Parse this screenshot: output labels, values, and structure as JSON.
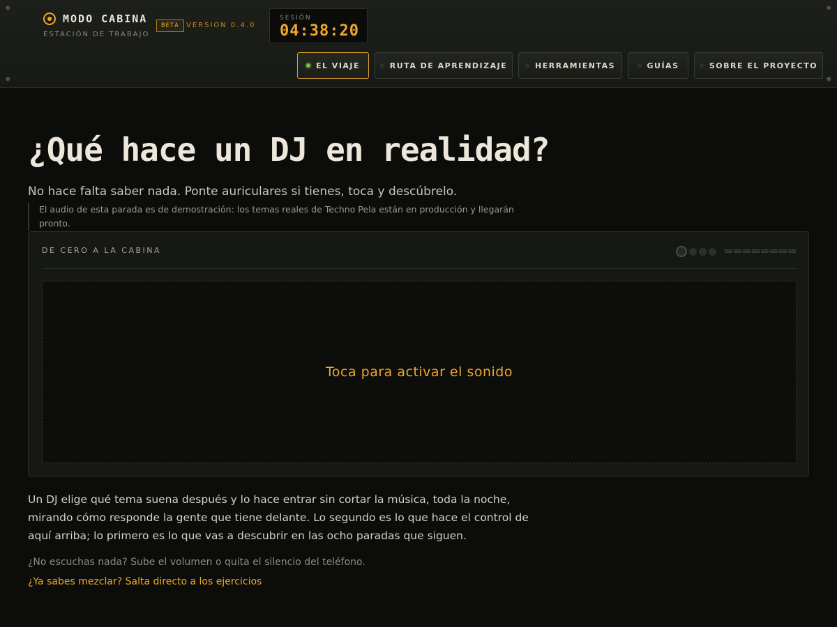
{
  "header": {
    "brand_title": "MODO CABINA",
    "brand_subtitle": "ESTACIÓN DE TRABAJO",
    "beta_badge": "BETA",
    "version": "VERSION 0.4.0",
    "session_label": "SESIÓN",
    "session_time": "04:38:20"
  },
  "nav": {
    "items": [
      {
        "label": "EL VIAJE",
        "active": true
      },
      {
        "label": "RUTA DE APRENDIZAJE",
        "active": false
      },
      {
        "label": "HERRAMIENTAS",
        "active": false
      },
      {
        "label": "GUÍAS",
        "active": false
      },
      {
        "label": "SOBRE EL PROYECTO",
        "active": false
      }
    ]
  },
  "main": {
    "title": "¿Qué hace un DJ en realidad?",
    "lead": "No hace falta saber nada. Ponte auriculares si tienes, toca y descúbrelo.",
    "note": "El audio de esta parada es de demostración: los temas reales de Techno Pela están en producción y llegarán pronto.",
    "panel_label": "DE CERO A LA CABINA",
    "activate_text": "Toca para activar el sonido",
    "body_text": "Un DJ elige qué tema suena después y lo hace entrar sin cortar la música, toda la noche, mirando cómo responde la gente que tiene delante. Lo segundo es lo que hace el control de aquí arriba; lo primero es lo que vas a descubrir en las ocho paradas que siguen.",
    "hint": "¿No escuchas nada? Sube el volumen o quita el silencio del teléfono.",
    "skip_link": "¿Ya sabes mezclar? Salta directo a los ejercicios"
  },
  "colors": {
    "accent": "#f0a728",
    "led_active": "#73c24a",
    "background": "#0c0d0b"
  },
  "icons": {
    "logo": "circle-target-icon",
    "status": "led-indicator-icon"
  }
}
